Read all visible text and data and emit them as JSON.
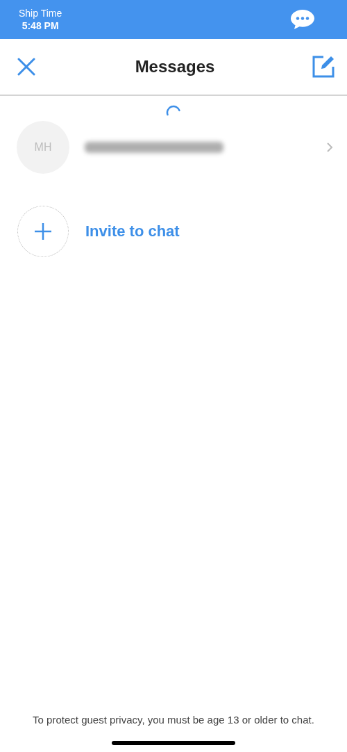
{
  "top_bar": {
    "label": "Ship Time",
    "time": "5:48 PM"
  },
  "nav": {
    "title": "Messages"
  },
  "loading": true,
  "conversations": [
    {
      "initials": "MH",
      "name_blurred": true
    }
  ],
  "invite": {
    "label": "Invite to chat"
  },
  "footer": {
    "notice": "To protect guest privacy, you must be age 13 or older to chat."
  }
}
